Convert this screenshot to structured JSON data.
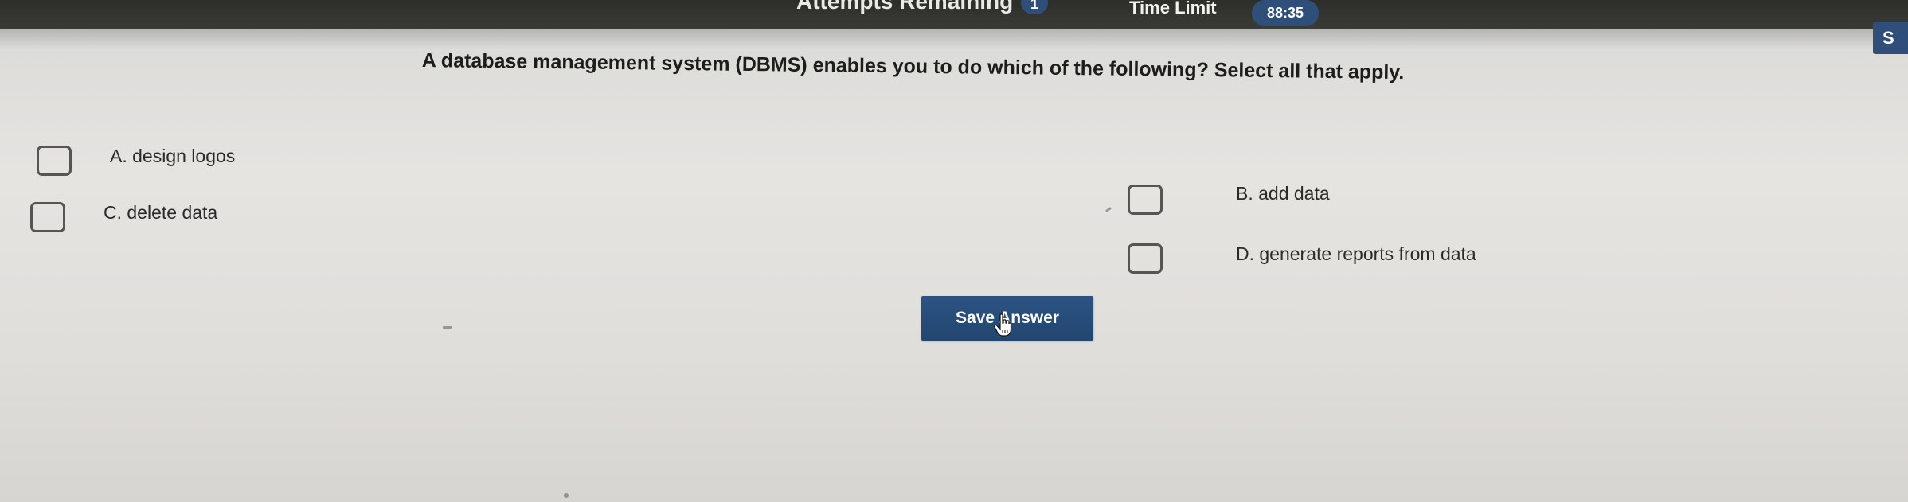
{
  "header": {
    "attempts_label": "Attempts Remaining",
    "attempts_count": "1",
    "time_limit_label": "Time Limit",
    "time_value": "88:35",
    "side_button_label": "S"
  },
  "question": {
    "text": "A database management system (DBMS) enables you to do which of the following? Select all that apply."
  },
  "options": [
    {
      "letter": "A",
      "label": "A. design logos",
      "checked": false
    },
    {
      "letter": "B",
      "label": "B. add data",
      "checked": false
    },
    {
      "letter": "C",
      "label": "C. delete data",
      "checked": false
    },
    {
      "letter": "D",
      "label": "D. generate reports from data",
      "checked": false
    }
  ],
  "actions": {
    "save_label": "Save Answer"
  },
  "colors": {
    "accent": "#2c5384",
    "topbar": "#2d2d2a",
    "background": "#e2e1de"
  },
  "icons": {
    "cursor": "hand-pointer-icon"
  }
}
